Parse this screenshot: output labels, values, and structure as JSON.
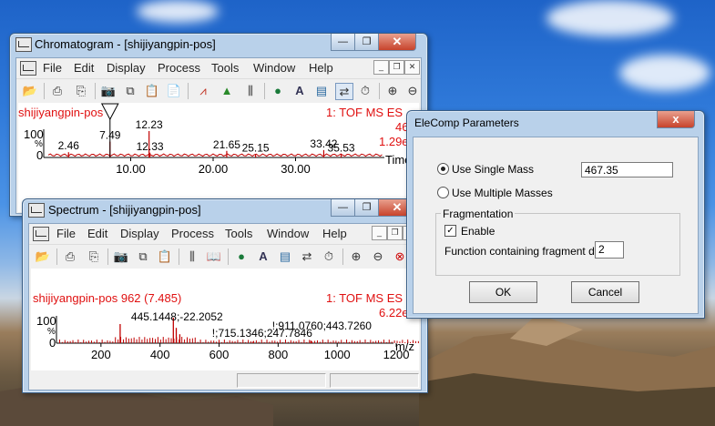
{
  "chromatogram": {
    "title": "Chromatogram - [shijiyangpin-pos]",
    "menu": [
      "File",
      "Edit",
      "Display",
      "Process",
      "Tools",
      "Window",
      "Help"
    ],
    "sample_label": "shijiyangpin-pos",
    "scan_label": "1: TOF MS ES",
    "mass_label": "46",
    "intensity_label": "1.29e",
    "y_max": "100",
    "y_unit": "%",
    "y_min": "0",
    "x_axis_title": "Time",
    "peak_labels": [
      "2.46",
      "7.49",
      "12.23",
      "12.33",
      "21.65",
      "25.15",
      "33.42",
      "35.53"
    ],
    "x_ticks": [
      "10.00",
      "20.00",
      "30.00"
    ],
    "chart_data": {
      "type": "line",
      "x_label": "Time",
      "x_ticks": [
        10.0,
        20.0,
        30.0
      ],
      "ylim": [
        0,
        100
      ],
      "peaks": [
        {
          "x": 2.46,
          "y": 20
        },
        {
          "x": 7.49,
          "y": 60
        },
        {
          "x": 12.23,
          "y": 100
        },
        {
          "x": 12.33,
          "y": 18
        },
        {
          "x": 21.65,
          "y": 25
        },
        {
          "x": 25.15,
          "y": 12
        },
        {
          "x": 33.42,
          "y": 28
        },
        {
          "x": 35.53,
          "y": 12
        }
      ]
    }
  },
  "spectrum": {
    "title": "Spectrum - [shijiyangpin-pos]",
    "menu": [
      "File",
      "Edit",
      "Display",
      "Process",
      "Tools",
      "Window",
      "Help"
    ],
    "sample_label": "shijiyangpin-pos 962 (7.485)",
    "scan_label": "1: TOF MS ES",
    "intensity_label": "6.22e",
    "y_max": "100",
    "y_unit": "%",
    "y_min": "0",
    "x_axis_title": "m/z",
    "peak_labels": [
      "445.1448;-22.2052",
      "!;715.1346;247.7846",
      "!;911.0760;443.7260"
    ],
    "x_ticks": [
      "200",
      "400",
      "600",
      "800",
      "1000",
      "1200"
    ],
    "chart_data": {
      "type": "bar",
      "x_label": "m/z",
      "x_ticks": [
        200,
        400,
        600,
        800,
        1000,
        1200
      ],
      "ylim": [
        0,
        100
      ],
      "peaks": [
        {
          "x": 265,
          "y": 75
        },
        {
          "x": 445.1448,
          "y": 100
        },
        {
          "x": 455,
          "y": 60
        },
        {
          "x": 467,
          "y": 35
        },
        {
          "x": 715.1346,
          "y": 6
        },
        {
          "x": 911.076,
          "y": 10
        }
      ]
    }
  },
  "dialog": {
    "title": "EleComp Parameters",
    "close_glyph": "x",
    "single_mass_label": "Use Single Mass",
    "single_mass_value": "467.35",
    "multiple_masses_label": "Use Multiple Masses",
    "fragmentation_label": "Fragmentation",
    "enable_label": "Enable",
    "function_label": "Function containing fragment data",
    "function_value": "2",
    "ok_label": "OK",
    "cancel_label": "Cancel"
  }
}
